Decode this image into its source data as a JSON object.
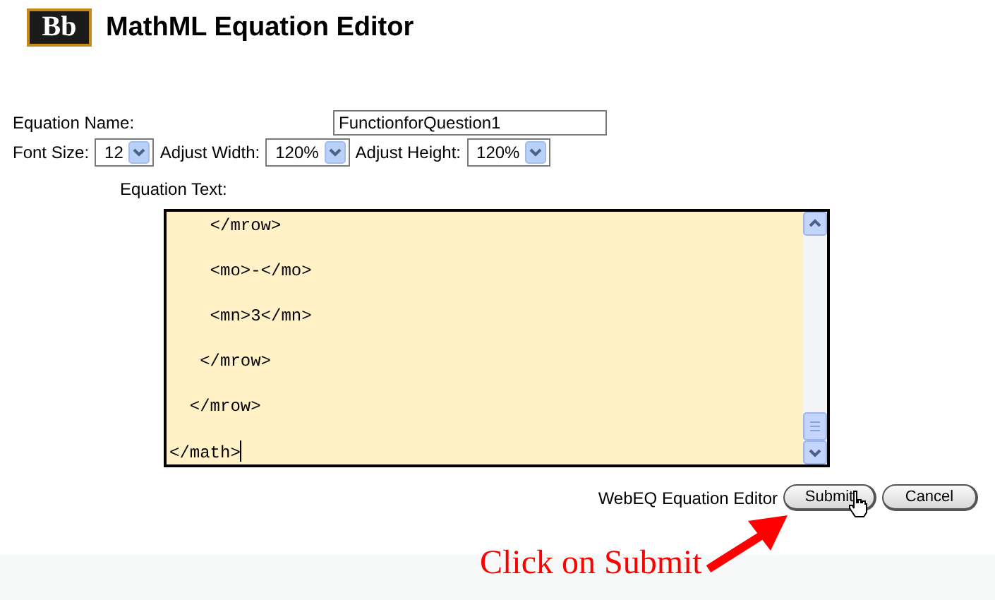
{
  "header": {
    "logo": "Bb",
    "title": "MathML Equation Editor"
  },
  "form": {
    "name_label": "Equation Name:",
    "name_value": "FunctionforQuestion1",
    "selects": [
      {
        "label": "Font Size:",
        "value": "12"
      },
      {
        "label": "Adjust Width:",
        "value": "120%"
      },
      {
        "label": "Adjust Height:",
        "value": "120%"
      }
    ],
    "text_label": "Equation Text:",
    "equation_text": "    </mrow>\n\n    <mo>-</mo>\n\n    <mn>3</mn>\n\n   </mrow>\n\n  </mrow>\n\n</math>"
  },
  "footer": {
    "editor_label": "WebEQ Equation Editor",
    "buttons": [
      "Submit",
      "Cancel"
    ]
  },
  "annotation": {
    "text": "Click on Submit"
  }
}
